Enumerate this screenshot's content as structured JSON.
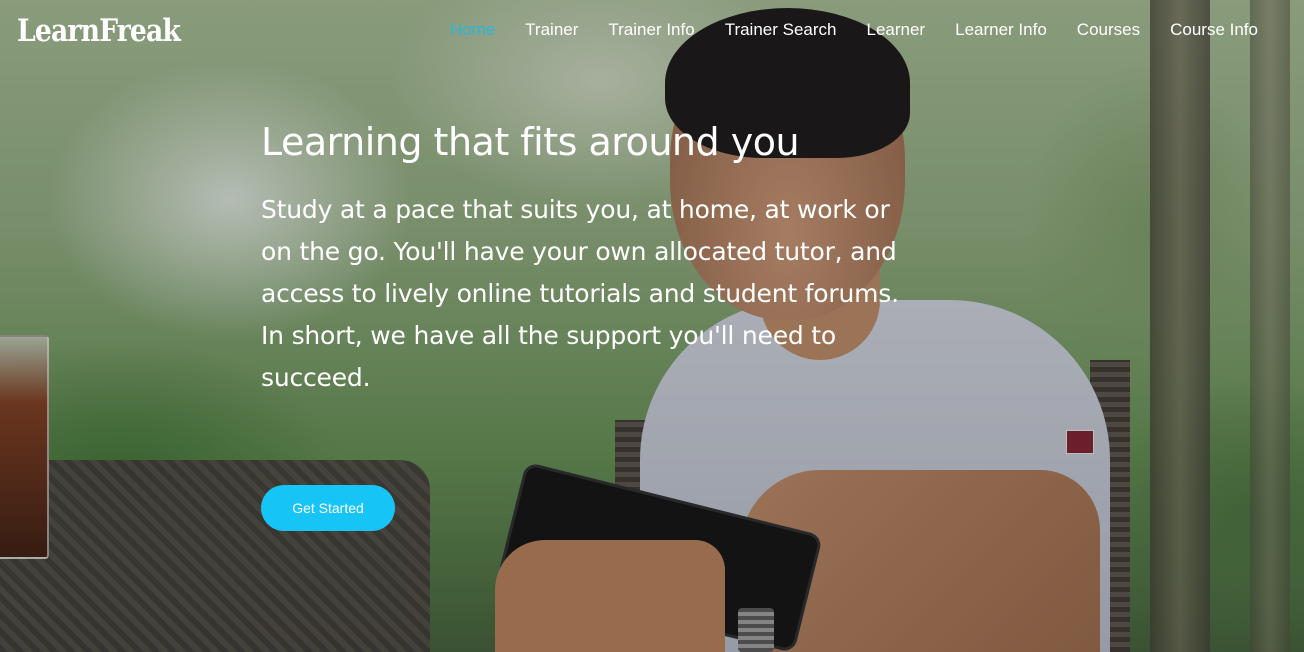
{
  "brand": {
    "name": "LearnFreak"
  },
  "nav": {
    "items": [
      {
        "label": "Home",
        "active": true
      },
      {
        "label": "Trainer",
        "active": false
      },
      {
        "label": "Trainer Info",
        "active": false
      },
      {
        "label": "Trainer Search",
        "active": false
      },
      {
        "label": "Learner",
        "active": false
      },
      {
        "label": "Learner Info",
        "active": false
      },
      {
        "label": "Courses",
        "active": false
      },
      {
        "label": "Course Info",
        "active": false
      }
    ]
  },
  "hero": {
    "title": "Learning that fits around you",
    "text": "Study at a pace that suits you, at home, at work or on the go. You'll have your own allocated tutor, and access to lively online tutorials and student forums. In short, we have all the support you'll need to succeed.",
    "cta_label": "Get Started"
  },
  "colors": {
    "accent": "#16c5f5",
    "active_nav": "#29b6d8",
    "text": "#ffffff"
  }
}
